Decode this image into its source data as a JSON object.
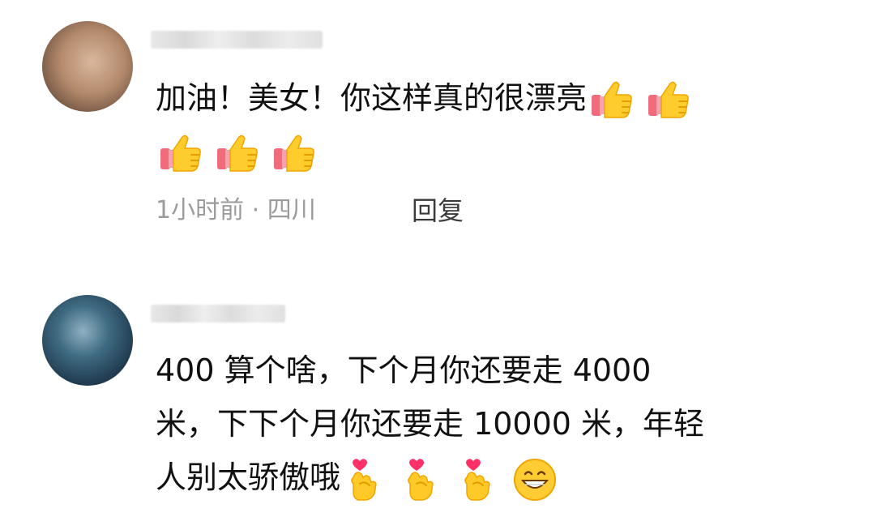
{
  "comments": [
    {
      "username_visible": false,
      "text_lines": [
        "加油！美女！你这样真的很漂亮",
        ""
      ],
      "emoji_line1": [
        "thumbs-up",
        "thumbs-up"
      ],
      "emoji_line2": [
        "thumbs-up",
        "thumbs-up",
        "thumbs-up"
      ],
      "time": "1小时前 · 四川",
      "reply_label": "回复"
    },
    {
      "username_visible": false,
      "text_lines": [
        "400 算个啥，下个月你还要走 4000",
        "米，下下个月你还要走 10000 米，年轻",
        "人别太骄傲哦"
      ],
      "emoji_line3": [
        "finger-heart",
        "finger-heart",
        "finger-heart",
        "grinning-face"
      ]
    }
  ],
  "colors": {
    "text": "#111111",
    "meta": "#9b9b9b",
    "reply": "#3a3a3a",
    "background": "#ffffff"
  }
}
